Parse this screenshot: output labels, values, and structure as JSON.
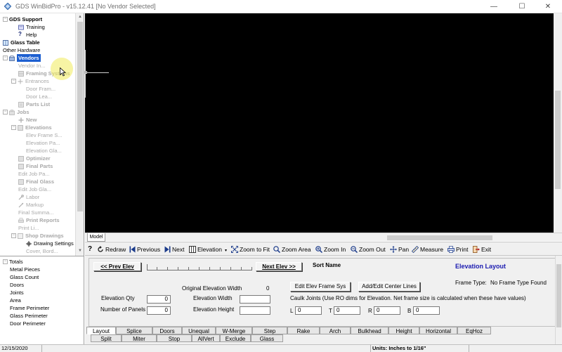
{
  "window": {
    "title": "GDS WinBidPro - v15.12.41  [No Vendor Selected]",
    "controls": [
      "—",
      "☐",
      "✕"
    ]
  },
  "tree": {
    "items": [
      {
        "label": "GDS Support",
        "style": "bold",
        "indent": 0
      },
      {
        "label": "Training",
        "style": "normal",
        "indent": 2
      },
      {
        "label": "Help",
        "style": "normal",
        "indent": 2
      },
      {
        "label": "Glass Table",
        "style": "bold",
        "indent": 0
      },
      {
        "label": "Other Hardware",
        "style": "normal",
        "indent": 0
      },
      {
        "label": "Vendors",
        "style": "selected",
        "indent": 1
      },
      {
        "label": "Vendor In...",
        "style": "disabled",
        "indent": 2
      },
      {
        "label": "Framing Systems",
        "style": "disabled-bold",
        "indent": 2
      },
      {
        "label": "Entrances",
        "style": "disabled",
        "indent": 2
      },
      {
        "label": "Door Fram...",
        "style": "disabled",
        "indent": 3
      },
      {
        "label": "Door Lea...",
        "style": "disabled",
        "indent": 3
      },
      {
        "label": "Parts List",
        "style": "disabled-bold",
        "indent": 2
      },
      {
        "label": "Jobs",
        "style": "disabled-bold",
        "indent": 1
      },
      {
        "label": "New",
        "style": "disabled-bold",
        "indent": 2
      },
      {
        "label": "Elevations",
        "style": "disabled-bold",
        "indent": 2
      },
      {
        "label": "Elev Frame S...",
        "style": "disabled",
        "indent": 3
      },
      {
        "label": "Elevation Pa...",
        "style": "disabled",
        "indent": 3
      },
      {
        "label": "Elevation Gla...",
        "style": "disabled",
        "indent": 3
      },
      {
        "label": "Optimizer",
        "style": "disabled-bold",
        "indent": 2
      },
      {
        "label": "Final Parts",
        "style": "disabled-bold",
        "indent": 2
      },
      {
        "label": "Edit Job Pa...",
        "style": "disabled",
        "indent": 1
      },
      {
        "label": "Final Glass",
        "style": "disabled-bold",
        "indent": 2
      },
      {
        "label": "Edit Job Gla...",
        "style": "disabled",
        "indent": 1
      },
      {
        "label": "Labor",
        "style": "disabled",
        "indent": 2
      },
      {
        "label": "Markup",
        "style": "disabled",
        "indent": 2
      },
      {
        "label": "Final Summa...",
        "style": "disabled",
        "indent": 1
      },
      {
        "label": "Print Reports",
        "style": "disabled-bold",
        "indent": 2
      },
      {
        "label": "Print Li...",
        "style": "disabled",
        "indent": 1
      },
      {
        "label": "Shop Drawings",
        "style": "disabled-bold",
        "indent": 2
      },
      {
        "label": "Drawing Settings",
        "style": "normal",
        "indent": 3
      },
      {
        "label": "Cover, Bord...",
        "style": "disabled",
        "indent": 3
      }
    ]
  },
  "canvas": {
    "background": "#000000",
    "model_tab": "Model"
  },
  "toolbar": {
    "help": "?",
    "redraw": "Redraw",
    "previous": "Previous",
    "next": "Next",
    "elevation": "Elevation",
    "zoom_to_fit": "Zoom to Fit",
    "zoom_area": "Zoom Area",
    "zoom_in": "Zoom In",
    "zoom_out": "Zoom Out",
    "pan": "Pan",
    "measure": "Measure",
    "print": "Print",
    "exit": "Exit"
  },
  "totals": {
    "items": [
      "Totals",
      "Metal Pieces",
      "Glass Count",
      "Doors",
      "Joints",
      "Area",
      "Frame Perimeter",
      "Glass Perimeter",
      "Door Perimeter"
    ]
  },
  "layout": {
    "prev_elev": "<< Prev Elev",
    "next_elev": "Next Elev >>",
    "sort_name": "Sort Name",
    "panel_title": "Elevation  Layout",
    "frame_type_label": "Frame Type:",
    "frame_type_value": "No Frame Type Found",
    "original_width_label": "Original Elevation Width",
    "original_width_value": "0",
    "edit_frame_sys": "Edit Elev Frame Sys",
    "add_edit_center": "Add/Edit Center Lines",
    "elevation_qty_label": "Elevation Qty",
    "elevation_qty_value": "0",
    "num_panels_label": "Number of Panels",
    "num_panels_value": "0",
    "elevation_width_label": "Elevation Width",
    "elevation_width_value": "",
    "elevation_height_label": "Elevation Height",
    "elevation_height_value": "",
    "caulk_joints": "Caulk Joints (Use RO dims for Elevation. Net frame size is calculated when these have values)",
    "caulk_l_label": "L",
    "caulk_l_value": "0",
    "caulk_t_label": "T",
    "caulk_t_value": "0",
    "caulk_r_label": "R",
    "caulk_r_value": "0",
    "caulk_b_label": "B",
    "caulk_b_value": "0",
    "title_color": "#1a1ab0"
  },
  "tabs": {
    "row1": [
      "Layout",
      "Splice",
      "Doors",
      "Unequal",
      "W-Merge",
      "Step",
      "Rake",
      "Arch",
      "Bulkhead",
      "Height",
      "Horizontal",
      "EqHoz"
    ],
    "row2": [
      "Split",
      "Miter",
      "Stop",
      "AllVert",
      "Exclude",
      "Glass"
    ],
    "active": "Layout"
  },
  "statusbar": {
    "date": "12/15/2020",
    "units": "Units: Inches to 1/16\""
  }
}
